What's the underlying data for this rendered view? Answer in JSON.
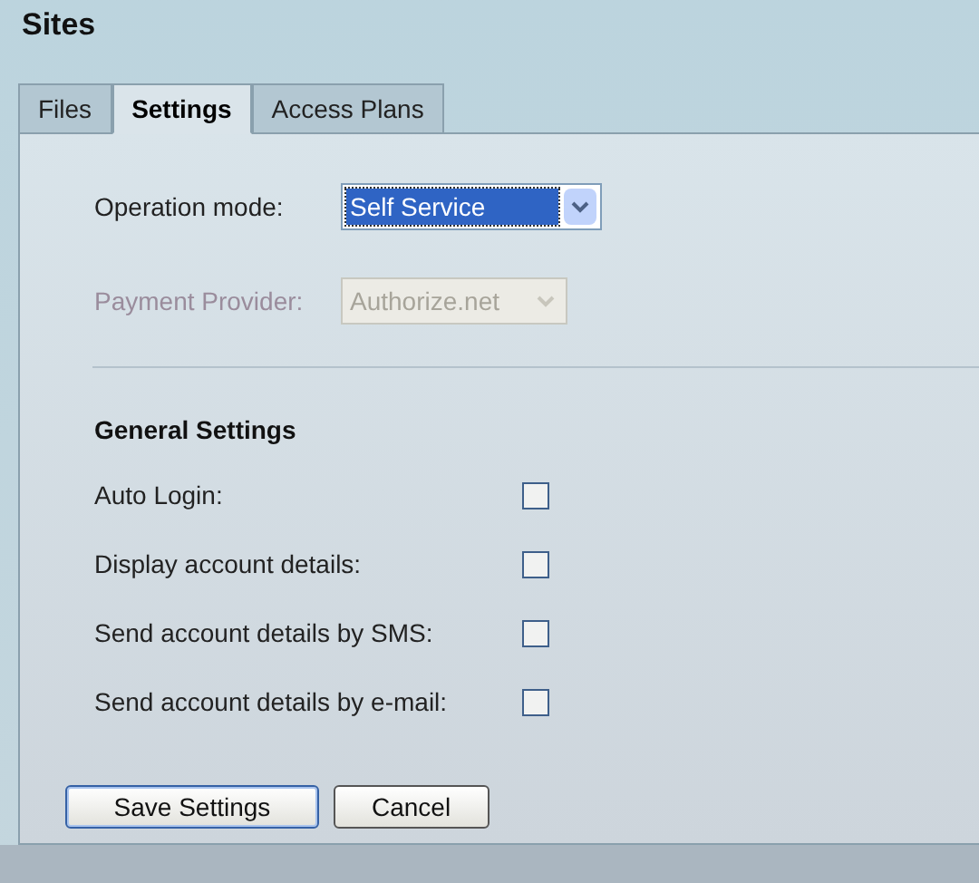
{
  "title": "Sites",
  "tabs": [
    {
      "label": "Files",
      "selected": false
    },
    {
      "label": "Settings",
      "selected": true
    },
    {
      "label": "Access Plans",
      "selected": false
    }
  ],
  "operation_mode": {
    "label": "Operation mode:",
    "value": "Self Service",
    "disabled": false,
    "focused": true
  },
  "payment_provider": {
    "label": "Payment Provider:",
    "value": "Authorize.net",
    "disabled": true,
    "focused": false
  },
  "section_title": "General Settings",
  "options": [
    {
      "label": "Auto Login:",
      "checked": false
    },
    {
      "label": "Display account details:",
      "checked": false
    },
    {
      "label": "Send account details by SMS:",
      "checked": false
    },
    {
      "label": "Send account details by e-mail:",
      "checked": false
    }
  ],
  "buttons": [
    {
      "label": "Save Settings",
      "default": true
    },
    {
      "label": "Cancel",
      "default": false
    }
  ]
}
